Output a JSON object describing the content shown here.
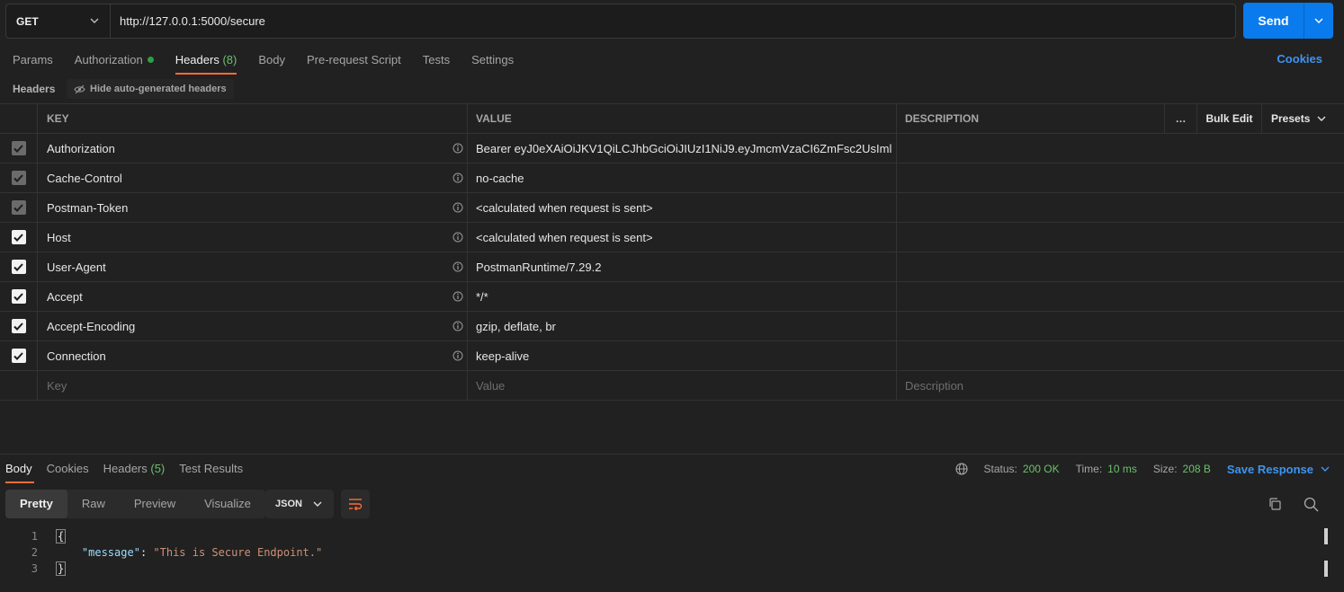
{
  "request": {
    "method": "GET",
    "url": "http://127.0.0.1:5000/secure",
    "send_label": "Send"
  },
  "tabs": [
    {
      "label": "Params"
    },
    {
      "label": "Authorization"
    },
    {
      "label": "Headers",
      "count": "(8)"
    },
    {
      "label": "Body"
    },
    {
      "label": "Pre-request Script"
    },
    {
      "label": "Tests"
    },
    {
      "label": "Settings"
    }
  ],
  "cookies_label": "Cookies",
  "headers_section": {
    "label": "Headers",
    "hide_auto_label": "Hide auto-generated headers"
  },
  "table": {
    "col_key": "KEY",
    "col_value": "VALUE",
    "col_description": "DESCRIPTION",
    "more_icon": "…",
    "bulk_edit": "Bulk Edit",
    "presets": "Presets",
    "rows": [
      {
        "key": "Authorization",
        "value": "Bearer eyJ0eXAiOiJKV1QiLCJhbGciOiJIUzI1NiJ9.eyJmcmVzaCI6ZmFsc2UsIml",
        "checked": true,
        "auto": true
      },
      {
        "key": "Cache-Control",
        "value": "no-cache",
        "checked": true,
        "auto": true
      },
      {
        "key": "Postman-Token",
        "value": "<calculated when request is sent>",
        "checked": true,
        "auto": true
      },
      {
        "key": "Host",
        "value": "<calculated when request is sent>",
        "checked": true,
        "auto": false
      },
      {
        "key": "User-Agent",
        "value": "PostmanRuntime/7.29.2",
        "checked": true,
        "auto": false
      },
      {
        "key": "Accept",
        "value": "*/*",
        "checked": true,
        "auto": false
      },
      {
        "key": "Accept-Encoding",
        "value": "gzip, deflate, br",
        "checked": true,
        "auto": false
      },
      {
        "key": "Connection",
        "value": "keep-alive",
        "checked": true,
        "auto": false
      }
    ],
    "placeholder_key": "Key",
    "placeholder_value": "Value",
    "placeholder_description": "Description"
  },
  "response": {
    "tabs": [
      {
        "label": "Body"
      },
      {
        "label": "Cookies"
      },
      {
        "label": "Headers",
        "count": "(5)"
      },
      {
        "label": "Test Results"
      }
    ],
    "status_label": "Status:",
    "status_value": "200 OK",
    "time_label": "Time:",
    "time_value": "10 ms",
    "size_label": "Size:",
    "size_value": "208 B",
    "save_response": "Save Response",
    "views": [
      "Pretty",
      "Raw",
      "Preview",
      "Visualize"
    ],
    "format": "JSON",
    "code": {
      "line_numbers": [
        "1",
        "2",
        "3"
      ],
      "open_brace": "{",
      "close_brace": "}",
      "json_key": "\"message\"",
      "json_colon": ": ",
      "json_value": "\"This is Secure Endpoint.\""
    }
  },
  "colors": {
    "accent": "#097bed",
    "tab_underline": "#ff6c37",
    "success": "#6cc06a",
    "link": "#3d95f2"
  }
}
